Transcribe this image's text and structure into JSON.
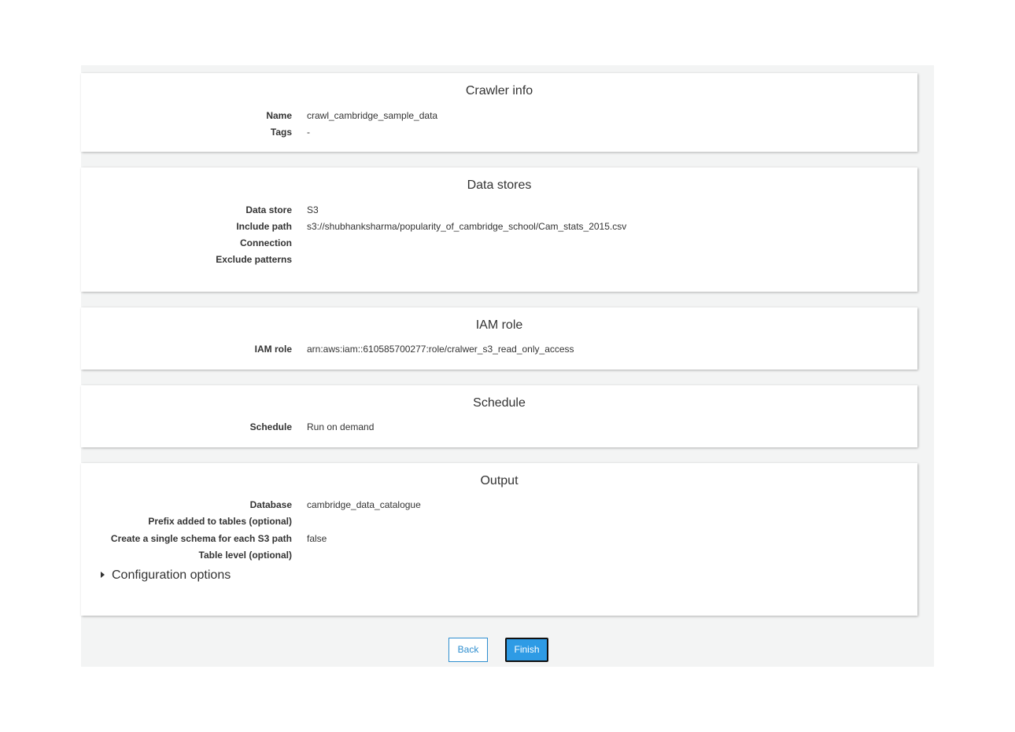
{
  "crawler_info": {
    "title": "Crawler info",
    "rows": [
      {
        "label": "Name",
        "value": "crawl_cambridge_sample_data"
      },
      {
        "label": "Tags",
        "value": "-"
      }
    ]
  },
  "data_stores": {
    "title": "Data stores",
    "rows": [
      {
        "label": "Data store",
        "value": "S3"
      },
      {
        "label": "Include path",
        "value": "s3://shubhanksharma/popularity_of_cambridge_school/Cam_stats_2015.csv"
      },
      {
        "label": "Connection",
        "value": ""
      },
      {
        "label": "Exclude patterns",
        "value": ""
      }
    ]
  },
  "iam_role": {
    "title": "IAM role",
    "rows": [
      {
        "label": "IAM role",
        "value": "arn:aws:iam::610585700277:role/cralwer_s3_read_only_access"
      }
    ]
  },
  "schedule": {
    "title": "Schedule",
    "rows": [
      {
        "label": "Schedule",
        "value": "Run on demand"
      }
    ]
  },
  "output": {
    "title": "Output",
    "rows": [
      {
        "label": "Database",
        "value": "cambridge_data_catalogue"
      },
      {
        "label": "Prefix added to tables (optional)",
        "value": ""
      },
      {
        "label": "Create a single schema for each S3 path",
        "value": "false"
      },
      {
        "label": "Table level (optional)",
        "value": ""
      }
    ],
    "config_options_label": "Configuration options"
  },
  "buttons": {
    "back_label": "Back",
    "finish_label": "Finish"
  },
  "colors": {
    "page_background": "#f3f4f4",
    "accent_blue": "#2e9be5",
    "link_blue": "#2e8ecf"
  },
  "icons": {
    "config_toggle": "caret-right-icon"
  }
}
